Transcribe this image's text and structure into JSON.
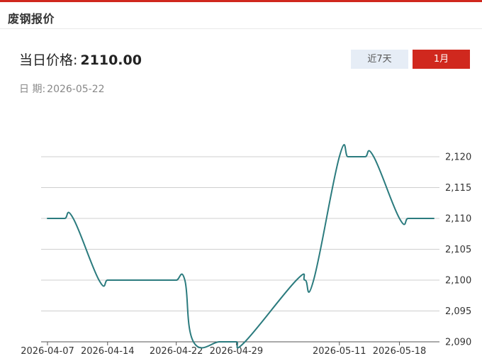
{
  "header": {
    "title": "废钢报价"
  },
  "summary": {
    "price_label": "当日价格:",
    "price_value": "2110.00",
    "date_label": "日  期:",
    "date_value": "2026-05-22"
  },
  "tabs": [
    {
      "label": "近7天",
      "active": false
    },
    {
      "label": "1月",
      "active": true
    }
  ],
  "colors": {
    "accent": "#d0281e",
    "line": "#2b7b7e",
    "grid": "#cfcfcf",
    "tab_inactive_bg": "#e6edf6"
  },
  "chart_data": {
    "type": "line",
    "title": "",
    "xlabel": "",
    "ylabel": "",
    "x_ticks": [
      "2026-04-07",
      "2026-04-14",
      "2026-04-22",
      "2026-04-29",
      "2026-05-11",
      "2026-05-18"
    ],
    "y_ticks": [
      "2,090",
      "2,095",
      "2,100",
      "2,105",
      "2,110",
      "2,115",
      "2,120"
    ],
    "ylim": [
      2090,
      2120
    ],
    "grid": true,
    "series": [
      {
        "x": [
          "2026-04-07",
          "2026-04-08",
          "2026-04-09",
          "2026-04-10",
          "2026-04-13",
          "2026-04-14",
          "2026-04-15",
          "2026-04-16",
          "2026-04-17",
          "2026-04-20",
          "2026-04-21",
          "2026-04-22",
          "2026-04-23",
          "2026-04-24",
          "2026-04-27",
          "2026-04-28",
          "2026-04-29",
          "2026-04-30",
          "2026-05-06",
          "2026-05-07",
          "2026-05-08",
          "2026-05-11",
          "2026-05-12",
          "2026-05-13",
          "2026-05-14",
          "2026-05-15",
          "2026-05-18",
          "2026-05-19",
          "2026-05-20",
          "2026-05-21",
          "2026-05-22"
        ],
        "values": [
          2110,
          2110,
          2110,
          2110,
          2100,
          2100,
          2100,
          2100,
          2100,
          2100,
          2100,
          2100,
          2100,
          2090,
          2090,
          2090,
          2090,
          2090,
          2100,
          2100,
          2100,
          2120,
          2120,
          2120,
          2120,
          2120,
          2110,
          2110,
          2110,
          2110,
          2110
        ]
      }
    ]
  }
}
